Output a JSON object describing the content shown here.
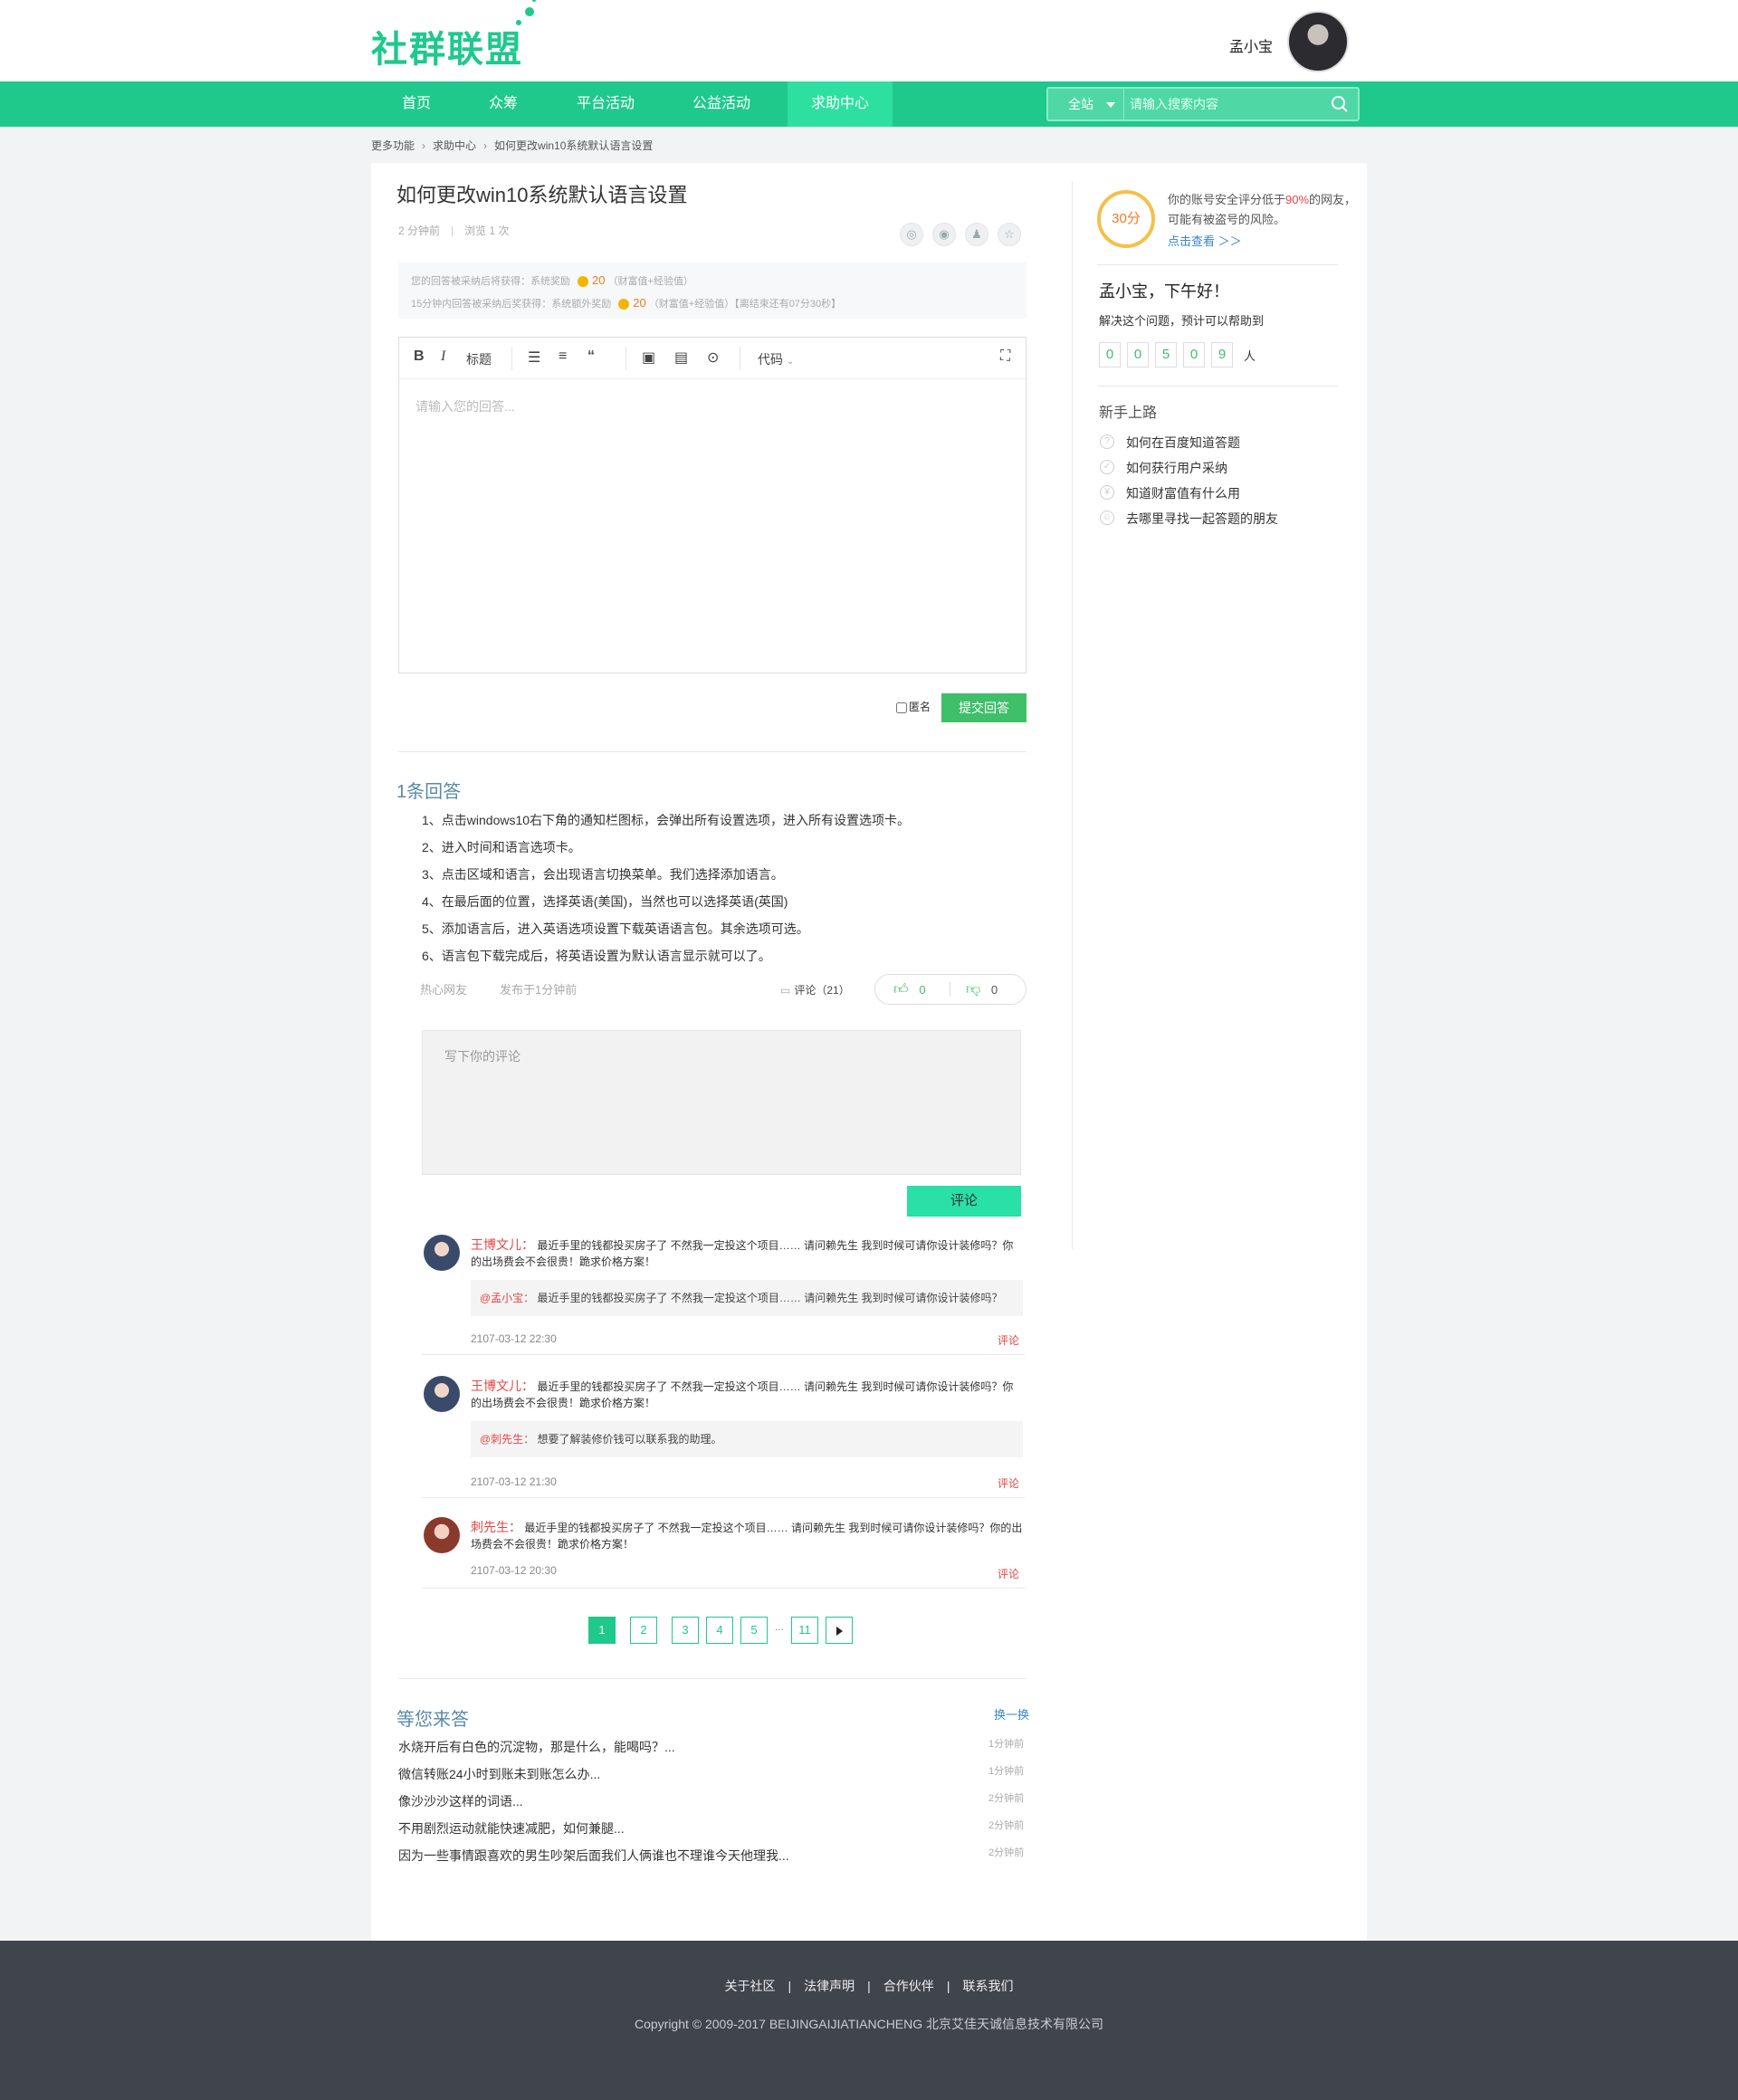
{
  "header": {
    "logo_text": "社群联盟",
    "username": "孟小宝",
    "nav": [
      "首页",
      "众筹",
      "平台活动",
      "公益活动",
      "求助中心"
    ],
    "search_scope": "全站",
    "search_placeholder": "请输入搜索内容"
  },
  "breadcrumb": [
    "更多功能",
    "求助中心",
    "如何更改win10系统默认语言设置"
  ],
  "question": {
    "title": "如何更改win10系统默认语言设置",
    "posted": "2 分钟前",
    "views": "浏览 1 次",
    "reward1_label": "您的回答被采纳后将获得：系统奖励",
    "reward1_value": "20",
    "reward1_note": "（财富值+经验值）",
    "reward2_label": "15分钟内回答被采纳后奖获得：系统额外奖励",
    "reward2_value": "20",
    "reward2_note": "（财富值+经验值）【离结束还有07分30秒】"
  },
  "editor": {
    "bold": "B",
    "italic": "I",
    "heading": "标题",
    "code": "代码",
    "placeholder": "请输入您的回答...",
    "anonymous_label": "匿名",
    "submit_label": "提交回答"
  },
  "answers": {
    "count_label": "1条回答",
    "steps": [
      "1、点击windows10右下角的通知栏图标，会弹出所有设置选项，进入所有设置选项卡。",
      "2、进入时间和语言选项卡。",
      "3、点击区域和语言，会出现语言切换菜单。我们选择添加语言。",
      "4、在最后面的位置，选择英语(美国)，当然也可以选择英语(英国)",
      "5、添加语言后，进入英语选项设置下载英语语言包。其余选项可选。",
      "6、语言包下载完成后，将英语设置为默认语言显示就可以了。"
    ],
    "author": "热心网友",
    "published": "发布于1分钟前",
    "comments_label": "评论（21）",
    "likes": "0",
    "dislikes": "0",
    "comment_placeholder": "写下你的评论",
    "comment_button": "评论"
  },
  "comments": [
    {
      "name": "王博文儿：",
      "text": "最近手里的钱都投买房子了 不然我一定投这个项目…… 请问赖先生 我到时候可请你设计装修吗？你的出场费会不会很贵！跪求价格方案！",
      "reply_to": "@孟小宝：",
      "reply_text": "最近手里的钱都投买房子了 不然我一定投这个项目…… 请问赖先生 我到时候可请你设计装修吗？",
      "date": "2107-03-12  22:30",
      "action": "评论"
    },
    {
      "name": "王博文儿：",
      "text": "最近手里的钱都投买房子了 不然我一定投这个项目…… 请问赖先生 我到时候可请你设计装修吗？你的出场费会不会很贵！跪求价格方案！",
      "reply_to": "@刺先生：",
      "reply_text": "想要了解装修价钱可以联系我的助理。",
      "date": "2107-03-12  21:30",
      "action": "评论"
    },
    {
      "name": "刺先生：",
      "text": "最近手里的钱都投买房子了 不然我一定投这个项目…… 请问赖先生 我到时候可请你设计装修吗？你的出场费会不会很贵！跪求价格方案！",
      "date": "2107-03-12  20:30",
      "action": "评论"
    }
  ],
  "pagination": [
    "1",
    "2",
    "3",
    "4",
    "5",
    "...",
    "11"
  ],
  "waiting": {
    "title": "等您来答",
    "refresh": "换一换",
    "items": [
      {
        "q": "水烧开后有白色的沉淀物，那是什么，能喝吗？...",
        "t": "1分钟前"
      },
      {
        "q": "微信转账24小时到账未到账怎么办...",
        "t": "1分钟前"
      },
      {
        "q": "像沙沙沙这样的词语...",
        "t": "2分钟前"
      },
      {
        "q": "不用剧烈运动就能快速减肥，如何兼腿...",
        "t": "2分钟前"
      },
      {
        "q": "因为一些事情跟喜欢的男生吵架后面我们人俩谁也不理谁今天他理我...",
        "t": "2分钟前"
      }
    ]
  },
  "sidebar": {
    "score": "30分",
    "security_text_1": "你的账号安全评分低于",
    "security_percent": "90%",
    "security_text_2": "的网友，可能有被盗号的风险。",
    "security_link": "点击查看 ＞＞",
    "greeting": "孟小宝，下午好！",
    "helped_text": "解决这个问题，预计可以帮助到",
    "helped_digits": [
      "0",
      "0",
      "5",
      "0",
      "9"
    ],
    "helped_unit": "人",
    "newbie_title": "新手上路",
    "newbie_items": [
      "如何在百度知道答题",
      "如何获行用户采纳",
      "知道财富值有什么用",
      "去哪里寻找一起答题的朋友"
    ]
  },
  "footer": {
    "links": [
      "关于社区",
      "法律声明",
      "合作伙伴",
      "联系我们"
    ],
    "copyright": "Copyright © 2009-2017 BEIJINGAIJIATIANCHENG 北京艾佳天诚信息技术有限公司"
  }
}
